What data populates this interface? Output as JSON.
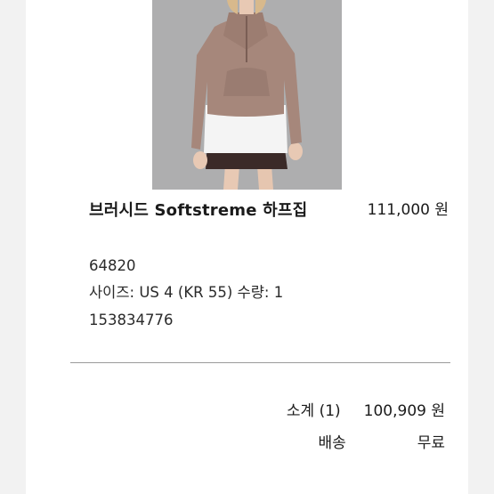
{
  "product": {
    "name": "브러시드 Softstreme 하프집",
    "price": "111,000 원",
    "sku": "64820",
    "options": "사이즈: US 4 (KR 55) 수량: 1",
    "code": "153834776"
  },
  "summary": {
    "subtotal_label": "소계 (1)",
    "subtotal_value": "100,909 원",
    "shipping_label": "배송",
    "shipping_value": "무료"
  }
}
